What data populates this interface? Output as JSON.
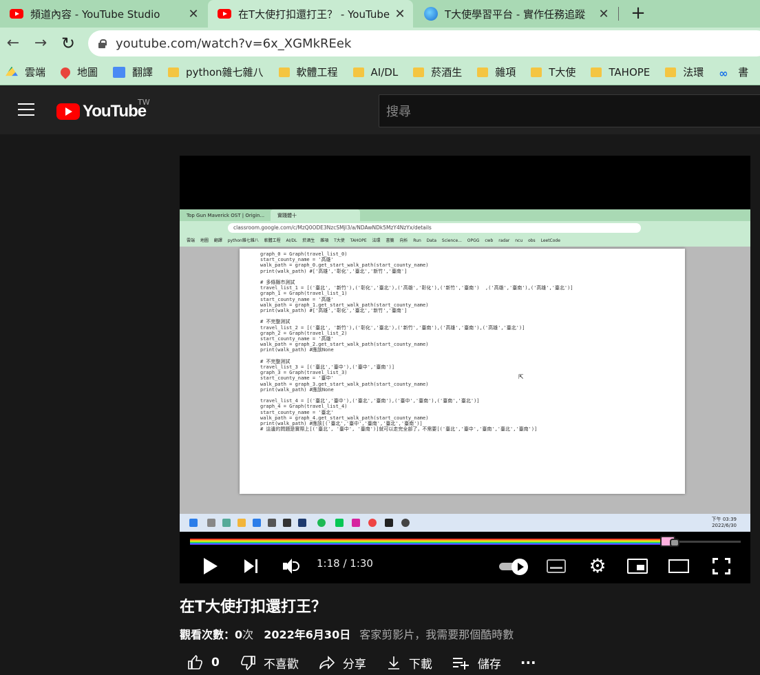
{
  "browser": {
    "tabs": [
      {
        "title": "頻道內容 - YouTube Studio",
        "icon": "youtube-icon"
      },
      {
        "title": "在T大使打扣還打王？ - YouTube",
        "icon": "youtube-icon",
        "active": true
      },
      {
        "title": "T大使學習平台 - 實作任務追蹤",
        "icon": "globe-icon"
      }
    ],
    "new_tab": "+",
    "url": "youtube.com/watch?v=6x_XGMkREek",
    "bookmarks": [
      "雲端",
      "地圖",
      "翻譯",
      "python雜七雜八",
      "軟體工程",
      "AI/DL",
      "菸酒生",
      "雜項",
      "T大使",
      "TAHOPE",
      "法環",
      "書"
    ]
  },
  "youtube": {
    "logo_text": "YouTube",
    "region": "TW",
    "search_placeholder": "搜尋"
  },
  "video": {
    "inner_screen": {
      "tabs": [
        "Top Gun Maverick OST | Origin...",
        "實踐體十"
      ],
      "url": "classroom.google.com/c/MzQ0ODE3NzcSMjI3/a/NDAwNDk5MzY4NzYx/details",
      "bookmarks": "雲端  地圖  翻譯  python雜七雜八  軟體工程  AI/DL  菸酒生  雜項  T大使  TAHOPE  法環  書籤  向析  Run Data Science...  OPGG  cwb radar  ncu obs  LeetCode",
      "clock_time": "下午 03:39",
      "clock_date": "2022/6/30",
      "code": [
        "graph_0 = Graph(travel_list_0)",
        "start_county_name = '高雄'",
        "walk_path = graph_0.get_start_walk_path(start_county_name)",
        "print(walk_path) #['高雄','彰化','臺北','新竹','臺南']",
        "",
        "# 多條縣市測試",
        "travel_list_1 = [('臺北', '新竹'),('彰化','臺北'),('高雄','彰化'),('新竹','臺南')  ,('高雄','臺南'),('高雄','臺北')]",
        "graph_1 = Graph(travel_list_1)",
        "start_county_name = '高雄'",
        "walk_path = graph_1.get_start_walk_path(start_county_name)",
        "print(walk_path) #['高雄','彰化','臺北','新竹','臺南']",
        "",
        "# 不完整測試",
        "travel_list_2 = [('臺北', '新竹'),('彰化','臺北'),('新竹','臺南'),('高雄','臺南'),('高雄','臺北')]",
        "graph_2 = Graph(travel_list_2)",
        "start_county_name = '高雄'",
        "walk_path = graph_2.get_start_walk_path(start_county_name)",
        "print(walk_path) #應該None",
        "",
        "# 不完整測試",
        "travel_list_3 = [('臺北','臺中'),('臺中','臺南')]",
        "graph_3 = Graph(travel_list_3)",
        "start_county_name = '臺中'",
        "walk_path = graph_3.get_start_walk_path(start_county_name)",
        "print(walk_path) #應該None",
        "",
        "travel_list_4 = [('臺北','臺中'),('臺北','臺南'),('臺中','臺南'),('臺南','臺北')]",
        "graph_4 = Graph(travel_list_4)",
        "start_county_name = '臺北'",
        "walk_path = graph_4.get_start_walk_path(start_county_name)",
        "print(walk_path) #應該[('臺北','臺中','臺南','臺北','臺南')]",
        "# 這邊的問題是實際上[('臺北', '臺中', '臺南')]就可以走完全部了，不需要[('臺北','臺中','臺南','臺北','臺南')]"
      ]
    },
    "time_display": "1:18 / 1:30",
    "progress_fraction": 0.8667,
    "title": "在T大使打扣還打王？",
    "views_label": "觀看次數：",
    "views_count": "0",
    "views_unit": "次",
    "date": "2022年6月30日",
    "description": "客家剪影片，我需要那個酷時數",
    "actions": {
      "like_count": "0",
      "dislike": "不喜歡",
      "share": "分享",
      "download": "下載",
      "save": "儲存",
      "more": "···"
    }
  }
}
